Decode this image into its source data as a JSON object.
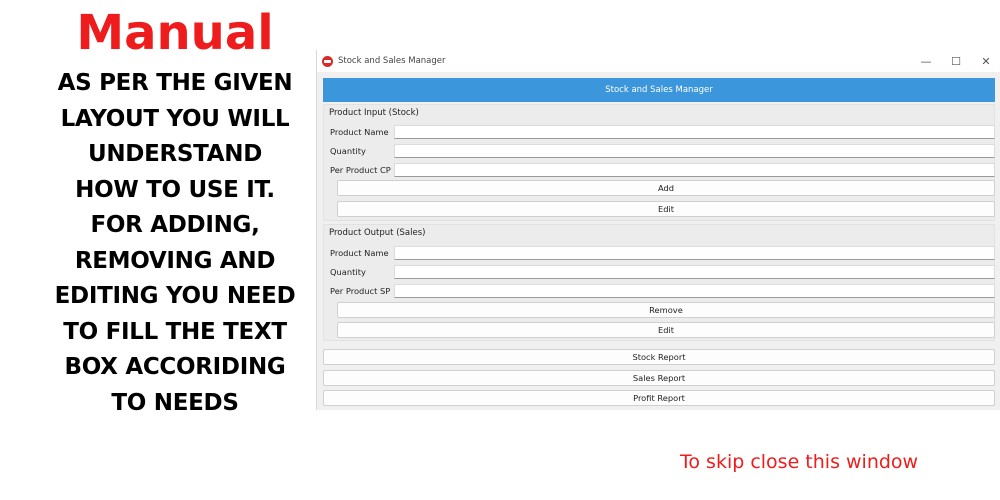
{
  "manual": {
    "title": "Manual",
    "instruction_lines": [
      "AS PER THE GIVEN",
      "LAYOUT YOU WILL",
      "UNDERSTAND",
      "HOW TO USE IT.",
      "FOR ADDING,",
      "REMOVING AND",
      "EDITING YOU NEED",
      "TO FILL THE TEXT",
      "BOX ACCORIDING",
      "TO NEEDS"
    ],
    "skip_note": "To skip close this window"
  },
  "window": {
    "title": "Stock and Sales Manager",
    "icon": "app-logo-icon",
    "controls": {
      "minimize": "—",
      "maximize": "☐",
      "close": "✕"
    }
  },
  "header": {
    "title": "Stock and Sales Manager",
    "color": "#3c96dc"
  },
  "stock_input": {
    "group_label": "Product Input (Stock)",
    "product_name_label": "Product Name",
    "product_name_value": "",
    "quantity_label": "Quantity",
    "quantity_value": "",
    "cp_label": "Per Product CP",
    "cp_value": "",
    "add_label": "Add",
    "edit_label": "Edit"
  },
  "sales_output": {
    "group_label": "Product Output (Sales)",
    "product_name_label": "Product Name",
    "product_name_value": "",
    "quantity_label": "Quantity",
    "quantity_value": "",
    "sp_label": "Per Product SP",
    "sp_value": "",
    "remove_label": "Remove",
    "edit_label": "Edit"
  },
  "reports": {
    "stock_label": "Stock Report",
    "sales_label": "Sales Report",
    "profit_label": "Profit Report"
  },
  "colors": {
    "accent_red": "#ee1c1c"
  }
}
